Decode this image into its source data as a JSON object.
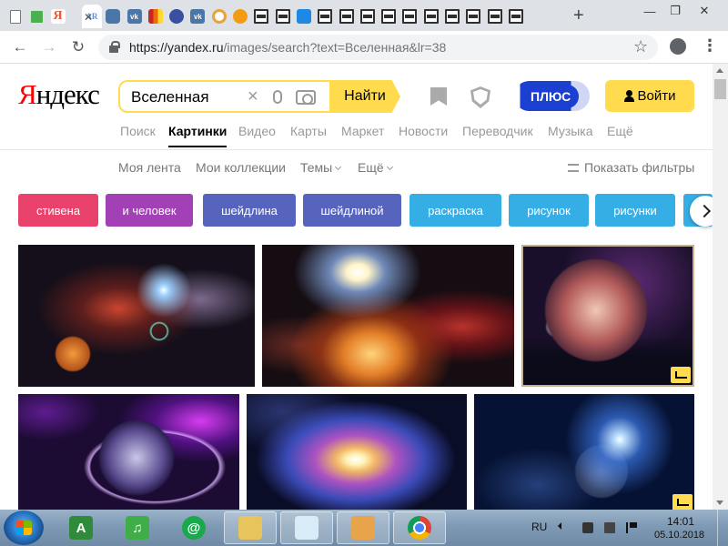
{
  "browser": {
    "tabs": [
      {
        "icon": "document-icon",
        "label": ""
      },
      {
        "icon": "green-square-icon",
        "label": ""
      },
      {
        "icon": "yandex-icon",
        "label": "Я"
      },
      {
        "icon": "ar-icon",
        "label": "AR"
      },
      {
        "icon": "chat-icon",
        "label": ""
      },
      {
        "icon": "vk-icon",
        "label": "vk"
      },
      {
        "icon": "colorful-icon",
        "label": ""
      },
      {
        "icon": "globe-icon",
        "label": ""
      },
      {
        "icon": "vk-icon",
        "label": "vk"
      },
      {
        "icon": "ring-icon",
        "label": ""
      },
      {
        "icon": "cat-icon",
        "label": ""
      },
      {
        "icon": "window-icon",
        "label": ""
      },
      {
        "icon": "window-icon",
        "label": ""
      },
      {
        "icon": "flower-icon",
        "label": ""
      },
      {
        "icon": "window-icon",
        "label": ""
      },
      {
        "icon": "window-icon",
        "label": ""
      },
      {
        "icon": "window-icon",
        "label": ""
      },
      {
        "icon": "window-icon",
        "label": ""
      },
      {
        "icon": "window-icon",
        "label": ""
      },
      {
        "icon": "window-icon",
        "label": ""
      },
      {
        "icon": "window-icon",
        "label": ""
      },
      {
        "icon": "window-icon",
        "label": ""
      },
      {
        "icon": "window-icon",
        "label": ""
      },
      {
        "icon": "window-icon",
        "label": ""
      }
    ],
    "new_tab_label": "+",
    "window_controls": {
      "minimize": "—",
      "restore": "❐",
      "close": "✕"
    },
    "url": {
      "host": "https://yandex.ru",
      "path": "/images/search?text=Вселенная&lr=38"
    }
  },
  "yandex": {
    "logo": {
      "first": "Я",
      "rest": "ндекс"
    },
    "search": {
      "query": "Вселенная",
      "button": "Найти"
    },
    "plus_label": "ПЛЮС",
    "login_label": "Войти",
    "services": [
      "Поиск",
      "Картинки",
      "Видео",
      "Карты",
      "Маркет",
      "Новости",
      "Переводчик",
      "Музыка",
      "Ещё"
    ],
    "active_service": "Картинки",
    "subnav": {
      "feed": "Моя лента",
      "collections": "Мои коллекции",
      "themes": "Темы",
      "more": "Ещё",
      "filters": "Показать фильтры"
    },
    "chips": [
      {
        "label": "стивена",
        "color": "#e9436d"
      },
      {
        "label": "и человек",
        "color": "#a141b5"
      },
      {
        "label": "шейдлина",
        "color": "#5664be"
      },
      {
        "label": "шейдлиной",
        "color": "#5664be"
      },
      {
        "label": "раскраска",
        "color": "#35aee6"
      },
      {
        "label": "рисунок",
        "color": "#35aee6"
      },
      {
        "label": "рисунки",
        "color": "#35aee6"
      }
    ]
  },
  "taskbar": {
    "apps": [
      {
        "icon": "android-icon",
        "glyph": "A",
        "color": "#2e8b3a"
      },
      {
        "icon": "music-icon",
        "glyph": "♫",
        "color": "#3fae49"
      },
      {
        "icon": "mail-icon",
        "glyph": "@",
        "color": "#1aa84d"
      },
      {
        "icon": "explorer-folder-icon",
        "glyph": "",
        "color": "#e8c45d"
      },
      {
        "icon": "notepad-icon",
        "glyph": "",
        "color": "#d7ecf7"
      },
      {
        "icon": "paint-icon",
        "glyph": "",
        "color": "#e7a44a"
      },
      {
        "icon": "chrome-icon",
        "glyph": "",
        "color": "#db4437"
      }
    ],
    "lang": "RU",
    "time": "14:01",
    "date": "05.10.2018"
  }
}
